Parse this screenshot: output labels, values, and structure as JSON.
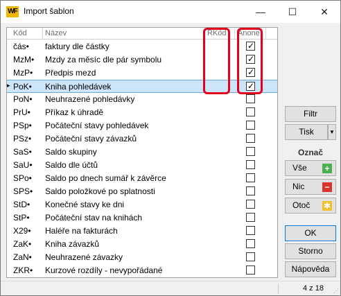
{
  "window": {
    "app_icon_text": "WF",
    "title": "Import šablon",
    "min_glyph": "—",
    "max_glyph": "☐",
    "close_glyph": "✕"
  },
  "grid": {
    "columns": {
      "kod": "Kód",
      "nazev": "Název",
      "rkod": "RKód",
      "anone": "Anone"
    },
    "current_row_marker": "▸",
    "rows": [
      {
        "kod": "čás•",
        "nazev": "faktury dle částky",
        "checked": true
      },
      {
        "kod": "MzM•",
        "nazev": "Mzdy za měsíc dle pár symbolu",
        "checked": true
      },
      {
        "kod": "MzP•",
        "nazev": "Předpis mezd",
        "checked": true
      },
      {
        "kod": "PoK•",
        "nazev": "Kniha pohledávek",
        "checked": true,
        "selected": true
      },
      {
        "kod": "PoN•",
        "nazev": "Neuhrazené pohledávky",
        "checked": false
      },
      {
        "kod": "PrU•",
        "nazev": "Příkaz k úhradě",
        "checked": false
      },
      {
        "kod": "PSp•",
        "nazev": "Počáteční stavy pohledávek",
        "checked": false
      },
      {
        "kod": "PSz•",
        "nazev": "Počáteční stavy závazků",
        "checked": false
      },
      {
        "kod": "SaS•",
        "nazev": "Saldo skupiny",
        "checked": false
      },
      {
        "kod": "SaU•",
        "nazev": "Saldo dle účtů",
        "checked": false
      },
      {
        "kod": "SPo•",
        "nazev": "Saldo po dnech sumář k závěrce",
        "checked": false
      },
      {
        "kod": "SPS•",
        "nazev": "Saldo položkové po splatnosti",
        "checked": false
      },
      {
        "kod": "StD•",
        "nazev": "Konečné stavy ke dni",
        "checked": false
      },
      {
        "kod": "StP•",
        "nazev": "Počáteční stav na knihách",
        "checked": false
      },
      {
        "kod": "X29•",
        "nazev": "Haléře na fakturách",
        "checked": false
      },
      {
        "kod": "ZaK•",
        "nazev": "Kniha závazků",
        "checked": false
      },
      {
        "kod": "ZaN•",
        "nazev": "Neuhrazené závazky",
        "checked": false
      },
      {
        "kod": "ZKR•",
        "nazev": "Kurzové rozdíly - nevypořádané",
        "checked": false
      }
    ]
  },
  "side": {
    "filtr": "Filtr",
    "tisk": "Tisk",
    "tisk_arrow": "▼",
    "oznac_label": "Označ",
    "vse": "Vše",
    "vse_icon": "+",
    "nic": "Nic",
    "nic_icon": "−",
    "otoc": "Otoč",
    "otoc_icon": "✱",
    "ok": "OK",
    "storno": "Storno",
    "napoveda": "Nápověda"
  },
  "colors": {
    "accent": "#e3001b",
    "selected_row": "#cde5fa",
    "plus": "#4caf50",
    "minus": "#d9342b",
    "star": "#f2c12e"
  },
  "status": {
    "position": "4 z 18"
  }
}
